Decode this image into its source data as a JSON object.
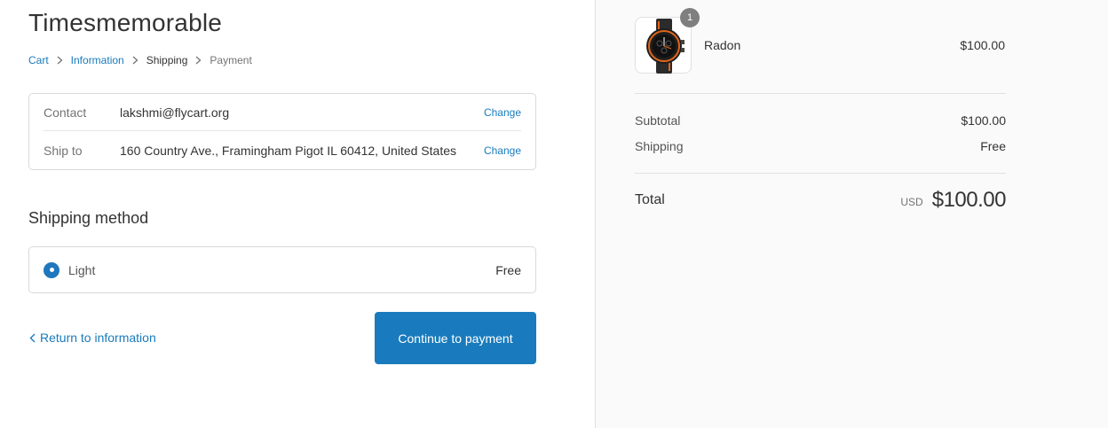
{
  "store": {
    "title": "Timesmemorable"
  },
  "breadcrumb": [
    {
      "label": "Cart"
    },
    {
      "label": "Information"
    },
    {
      "label": "Shipping"
    },
    {
      "label": "Payment"
    }
  ],
  "review": {
    "contact": {
      "label": "Contact",
      "value": "lakshmi@flycart.org",
      "action": "Change"
    },
    "ship_to": {
      "label": "Ship to",
      "value": "160 Country Ave., Framingham Pigot IL 60412, United States",
      "action": "Change"
    }
  },
  "shipping_method": {
    "title": "Shipping method",
    "options": [
      {
        "name": "Light",
        "price": "Free",
        "selected": true
      }
    ]
  },
  "actions": {
    "return_label": "Return to information",
    "continue_label": "Continue to payment"
  },
  "order_summary": {
    "items": [
      {
        "name": "Radon",
        "price": "$100.00",
        "quantity": "1",
        "image_icon": "watch-icon"
      }
    ],
    "subtotal_label": "Subtotal",
    "subtotal_value": "$100.00",
    "shipping_label": "Shipping",
    "shipping_value": "Free",
    "total_label": "Total",
    "currency": "USD",
    "total_value": "$100.00"
  },
  "colors": {
    "accent": "#197bbd",
    "sidebar_bg": "#fafafa",
    "badge": "#7f7f7f"
  }
}
